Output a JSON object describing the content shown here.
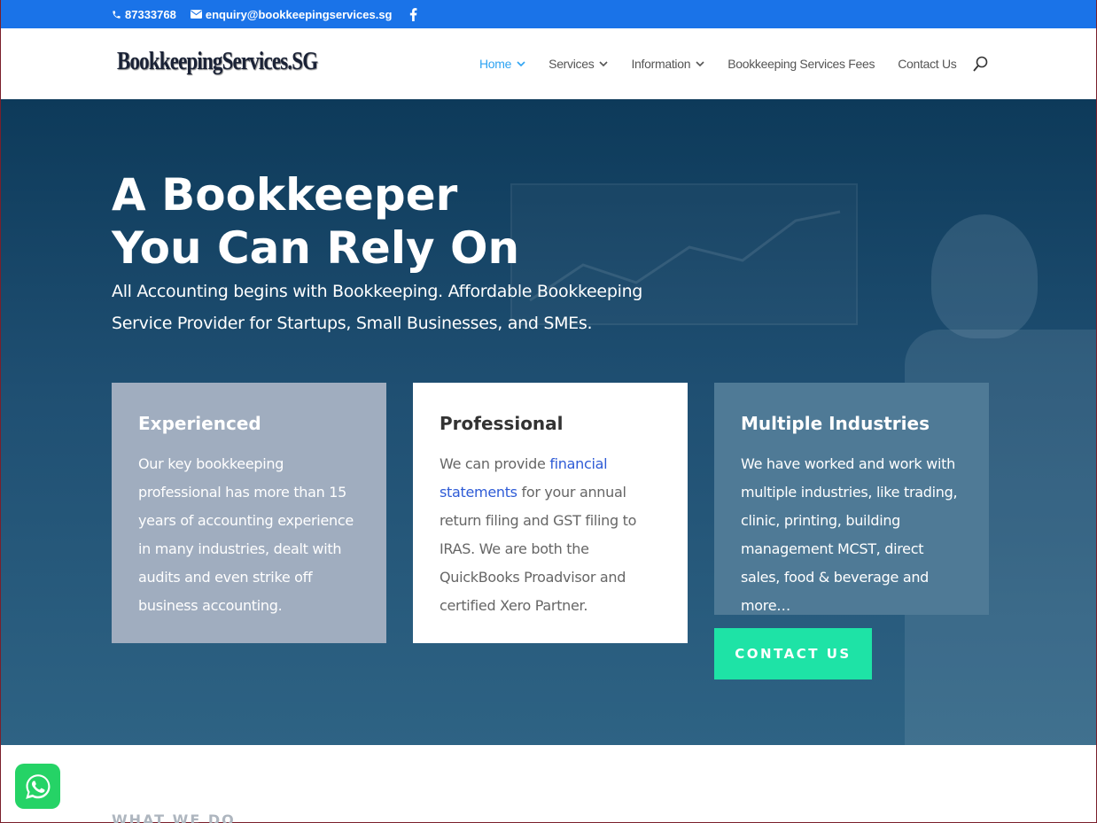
{
  "topbar": {
    "phone": "87333768",
    "email": "enquiry@bookkeepingservices.sg",
    "social_icon": "facebook-icon"
  },
  "header": {
    "logo_text": "BookkeepingServices.SG",
    "nav": [
      {
        "label": "Home",
        "active": true,
        "dropdown": true
      },
      {
        "label": "Services",
        "active": false,
        "dropdown": true
      },
      {
        "label": "Information",
        "active": false,
        "dropdown": true
      },
      {
        "label": "Bookkeeping Services Fees",
        "active": false,
        "dropdown": false
      },
      {
        "label": "Contact Us",
        "active": false,
        "dropdown": false
      }
    ],
    "search_icon": "search-icon"
  },
  "hero": {
    "title_line1": "A Bookkeeper",
    "title_line2": "You Can Rely On",
    "subtitle": "All Accounting begins with Bookkeeping. Affordable Bookkeeping Service Provider for Startups, Small Businesses, and SMEs.",
    "cards": [
      {
        "title": "Experienced",
        "text": "Our key bookkeeping professional has more than 15 years of accounting experience in many industries, dealt with audits and even strike off business accounting."
      },
      {
        "title": "Professional",
        "text_before": "We can provide ",
        "link": "financial statements",
        "text_after": " for your annual return filing and GST filing to IRAS. We are both the QuickBooks Proadvisor and certified Xero Partner."
      },
      {
        "title": "Multiple Industries",
        "text": "We have worked and work with multiple industries, like trading, clinic, printing, building management MCST, direct sales, food & beverage and more…"
      }
    ],
    "cta_label": "CONTACT US"
  },
  "section": {
    "what_we_do": "WHAT WE DO"
  },
  "colors": {
    "topbar": "#1a73e8",
    "nav_active": "#2ea3f2",
    "cta": "#1ee3a6",
    "whatsapp": "#25d366"
  }
}
